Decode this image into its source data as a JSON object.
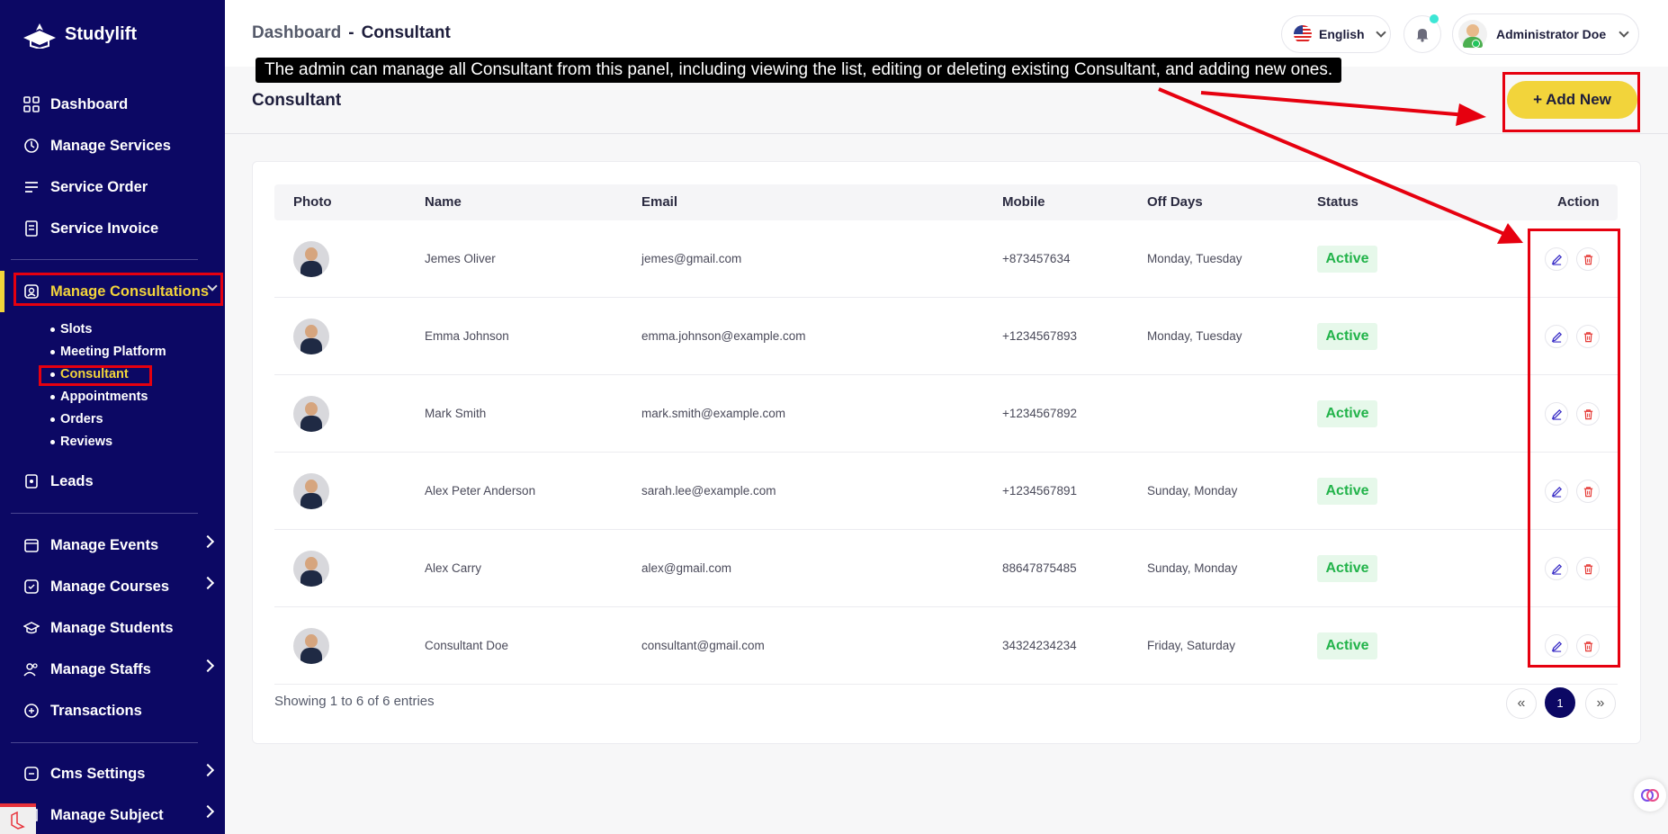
{
  "app": {
    "name": "Studylift"
  },
  "sidebar": {
    "items": [
      {
        "label": "Dashboard",
        "icon": "dashboard-icon"
      },
      {
        "label": "Manage Services",
        "icon": "services-icon"
      },
      {
        "label": "Service Order",
        "icon": "order-icon"
      },
      {
        "label": "Service Invoice",
        "icon": "invoice-icon"
      },
      {
        "label": "Manage Consultations",
        "icon": "consultation-icon"
      },
      {
        "label": "Leads",
        "icon": "leads-icon"
      },
      {
        "label": "Manage Events",
        "icon": "calendar-icon"
      },
      {
        "label": "Manage Courses",
        "icon": "courses-icon"
      },
      {
        "label": "Manage Students",
        "icon": "students-icon"
      },
      {
        "label": "Manage Staffs",
        "icon": "staff-icon"
      },
      {
        "label": "Transactions",
        "icon": "transactions-icon"
      },
      {
        "label": "Cms Settings",
        "icon": "settings-icon"
      },
      {
        "label": "Manage Subject",
        "icon": "subject-icon"
      }
    ],
    "sub_items": [
      "Slots",
      "Meeting Platform",
      "Consultant",
      "Appointments",
      "Orders",
      "Reviews"
    ],
    "active_item": "Manage Consultations",
    "active_sub_item": "Consultant"
  },
  "header": {
    "breadcrumb_home": "Dashboard",
    "breadcrumb_sep": "-",
    "breadcrumb_current": "Consultant",
    "language": "English",
    "user_name": "Administrator Doe"
  },
  "annotation": {
    "text": "The admin can manage all Consultant from this panel, including viewing the list, editing or deleting existing Consultant, and adding new ones."
  },
  "page": {
    "title": "Consultant",
    "add_button": "+ Add New"
  },
  "table": {
    "columns": [
      "Photo",
      "Name",
      "Email",
      "Mobile",
      "Off Days",
      "Status",
      "Action"
    ],
    "rows": [
      {
        "name": "Jemes Oliver",
        "email": "jemes@gmail.com",
        "mobile": "+873457634",
        "off_days": "Monday, Tuesday",
        "status": "Active"
      },
      {
        "name": "Emma Johnson",
        "email": "emma.johnson@example.com",
        "mobile": "+1234567893",
        "off_days": "Monday, Tuesday",
        "status": "Active"
      },
      {
        "name": "Mark Smith",
        "email": "mark.smith@example.com",
        "mobile": "+1234567892",
        "off_days": "",
        "status": "Active"
      },
      {
        "name": "Alex Peter Anderson",
        "email": "sarah.lee@example.com",
        "mobile": "+1234567891",
        "off_days": "Sunday, Monday",
        "status": "Active"
      },
      {
        "name": "Alex Carry",
        "email": "alex@gmail.com",
        "mobile": "88647875485",
        "off_days": "Sunday, Monday",
        "status": "Active"
      },
      {
        "name": "Consultant Doe",
        "email": "consultant@gmail.com",
        "mobile": "34324234234",
        "off_days": "Friday, Saturday",
        "status": "Active"
      }
    ],
    "entries_text": "Showing 1 to 6 of 6 entries",
    "pagination": {
      "prev": "«",
      "current": "1",
      "next": "»"
    }
  },
  "colors": {
    "sidebar_bg": "#0c0864",
    "accent": "#f2d43b",
    "status_active": "#22b34a",
    "highlight": "#e6000f"
  }
}
